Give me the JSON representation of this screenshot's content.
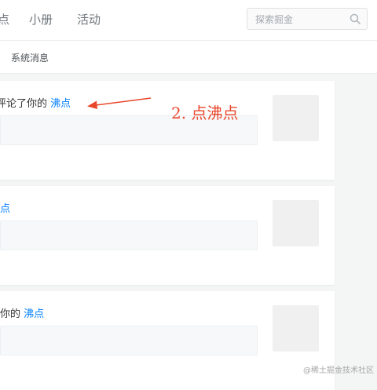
{
  "header": {
    "nav": [
      "点",
      "小册",
      "活动"
    ],
    "search_placeholder": "探索掘金"
  },
  "subnav": {
    "active_tab": "系统消息"
  },
  "cards": [
    {
      "text": "评论了你的",
      "link": "沸点"
    },
    {
      "text": "",
      "link": "点"
    },
    {
      "text": "你的",
      "link": "沸点"
    }
  ],
  "annotation": {
    "label": "2. 点沸点",
    "color": "#e9472c"
  },
  "watermark": "@稀土掘金技术社区",
  "colors": {
    "link": "#007fff",
    "page_bg": "#f4f5f5",
    "annotation": "#e9472c"
  }
}
